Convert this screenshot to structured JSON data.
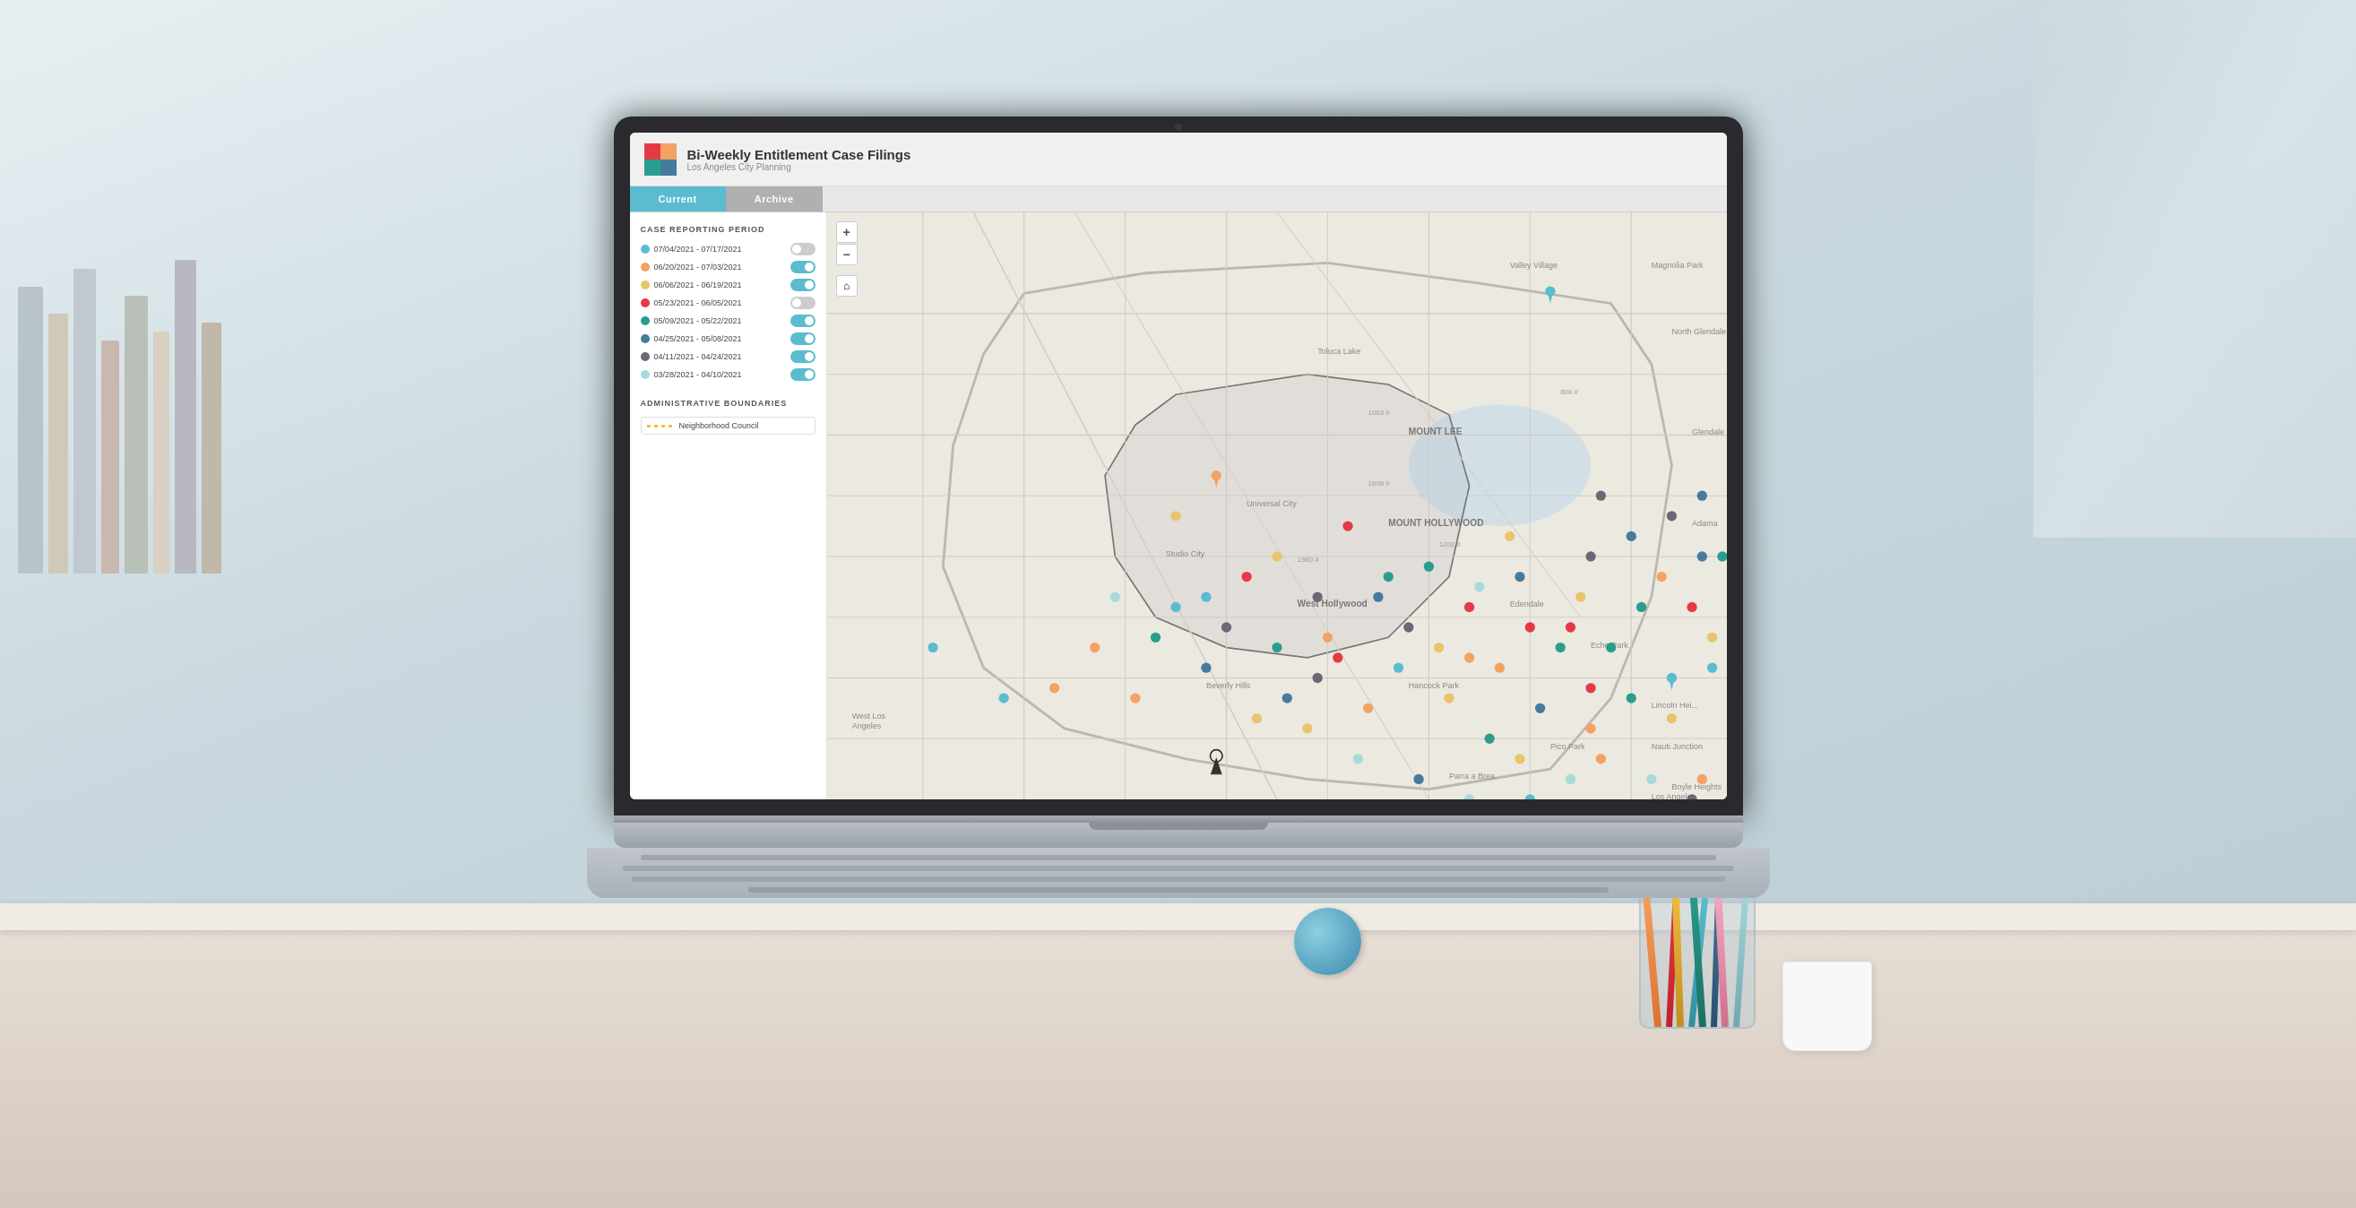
{
  "app": {
    "title": "Bi-Weekly Entitlement Case Filings",
    "subtitle": "Los Angeles City Planning",
    "logo_alt": "LA City Planning Logo"
  },
  "tabs": [
    {
      "label": "Current",
      "active": true
    },
    {
      "label": "Archive",
      "active": false
    }
  ],
  "left_panel": {
    "case_reporting_section": "CASE REPORTING PERIOD",
    "periods": [
      {
        "label": "07/04/2021 - 07/17/2021",
        "color": "#5bbcd0",
        "toggle": "off"
      },
      {
        "label": "06/20/2021 - 07/03/2021",
        "color": "#f4a261",
        "toggle": "on"
      },
      {
        "label": "06/06/2021 - 06/19/2021",
        "color": "#e9c46a",
        "toggle": "on"
      },
      {
        "label": "05/23/2021 - 06/05/2021",
        "color": "#e63946",
        "toggle": "off"
      },
      {
        "label": "05/09/2021 - 05/22/2021",
        "color": "#2a9d8f",
        "toggle": "on"
      },
      {
        "label": "04/25/2021 - 05/08/2021",
        "color": "#457b9d",
        "toggle": "on"
      },
      {
        "label": "04/11/2021 - 04/24/2021",
        "color": "#6d6875",
        "toggle": "on"
      },
      {
        "label": "03/28/2021 - 04/10/2021",
        "color": "#a8dadc",
        "toggle": "on"
      }
    ],
    "admin_boundaries_section": "ADMINISTRATIVE BOUNDARIES",
    "boundary_item": "Neighborhood Council"
  },
  "map": {
    "zoom_in": "+",
    "zoom_out": "−",
    "home": "⌂"
  },
  "icons": {
    "toggle_on": "●",
    "toggle_off": "○",
    "pin": "📍"
  }
}
